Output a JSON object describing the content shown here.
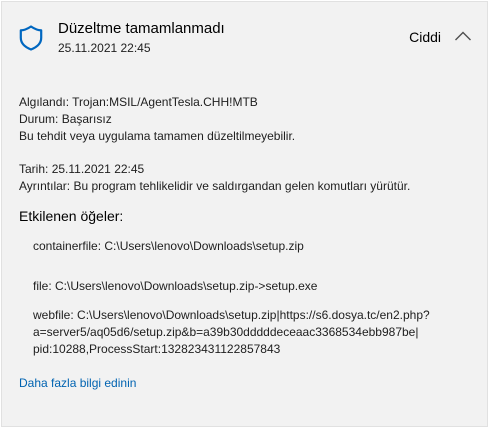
{
  "header": {
    "shield_icon": "shield-icon",
    "title": "Düzeltme tamamlanmadı",
    "timestamp": "25.11.2021 22:45",
    "severity": "Ciddi",
    "collapse_icon": "chevron-up-icon"
  },
  "details": {
    "detected_label": "Algılandı:",
    "detected_value": "Trojan:MSIL/AgentTesla.CHH!MTB",
    "status_label": "Durum:",
    "status_value": "Başarısız",
    "status_note": "Bu tehdit veya uygulama tamamen düzeltilmeyebilir.",
    "date_label": "Tarih:",
    "date_value": "25.11.2021 22:45",
    "details_label": "Ayrıntılar:",
    "details_value": "Bu program tehlikelidir ve saldırgandan gelen komutları yürütür."
  },
  "affected": {
    "heading": "Etkilenen öğeler:",
    "items": [
      {
        "lines": [
          "containerfile: C:\\Users\\lenovo\\Downloads\\setup.zip"
        ]
      },
      {
        "lines": [
          "file: C:\\Users\\lenovo\\Downloads\\setup.zip->setup.exe"
        ]
      },
      {
        "lines": [
          "webfile: C:\\Users\\lenovo\\Downloads\\setup.zip|https://s6.dosya.tc/en2.php?",
          "a=server5/aq05d6/setup.zip&b=a39b30dddddeceaac3368534ebb987be|",
          "pid:10288,ProcessStart:132823431122857843"
        ]
      }
    ]
  },
  "links": {
    "learn_more": "Daha fazla bilgi edinin"
  },
  "colors": {
    "panel_background": "#f2f2f2",
    "shield_icon": "#0067c0",
    "link": "#0063b1"
  }
}
